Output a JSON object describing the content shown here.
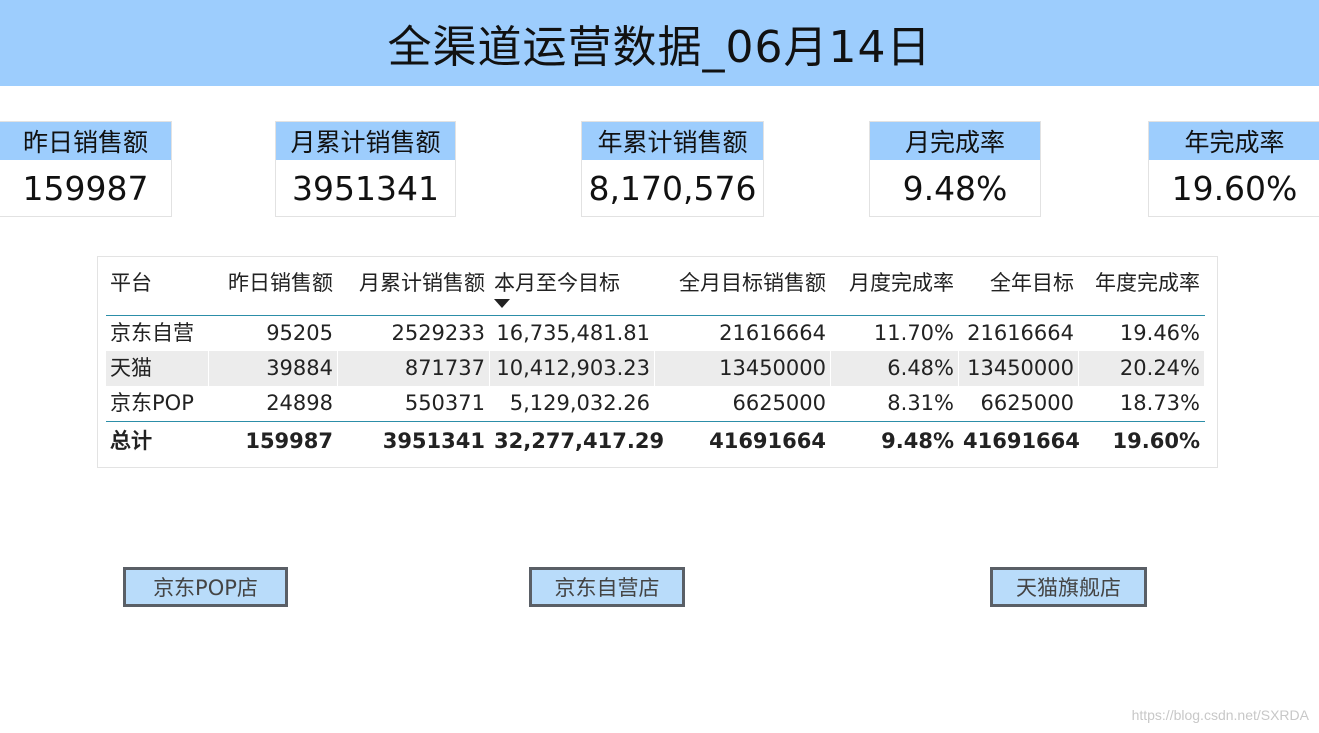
{
  "banner": {
    "title": "全渠道运营数据_06月14日"
  },
  "kpis": [
    {
      "label": "昨日销售额",
      "value": "159987"
    },
    {
      "label": "月累计销售额",
      "value": "3951341"
    },
    {
      "label": "年累计销售额",
      "value": "8,170,576"
    },
    {
      "label": "月完成率",
      "value": "9.48%"
    },
    {
      "label": "年完成率",
      "value": "19.60%"
    }
  ],
  "table": {
    "columns": [
      "平台",
      "昨日销售额",
      "月累计销售额",
      "本月至今目标",
      "全月目标销售额",
      "月度完成率",
      "全年目标",
      "年度完成率"
    ],
    "rows": [
      [
        "京东自营",
        "95205",
        "2529233",
        "16,735,481.81",
        "21616664",
        "11.70%",
        "21616664",
        "19.46%"
      ],
      [
        "天猫",
        "39884",
        "871737",
        "10,412,903.23",
        "13450000",
        "6.48%",
        "13450000",
        "20.24%"
      ],
      [
        "京东POP",
        "24898",
        "550371",
        "5,129,032.26",
        "6625000",
        "8.31%",
        "6625000",
        "18.73%"
      ]
    ],
    "total": [
      "总计",
      "159987",
      "3951341",
      "32,277,417.29",
      "41691664",
      "9.48%",
      "41691664",
      "19.60%"
    ],
    "sort_icon": "sort-descending-icon"
  },
  "nav_buttons": [
    {
      "label": "京东POP店"
    },
    {
      "label": "京东自营店"
    },
    {
      "label": "天猫旗舰店"
    }
  ],
  "watermark": "https://blog.csdn.net/SXRDA",
  "colors": {
    "accent": "#9dcdfd",
    "button_fill": "#b9dcfa",
    "separator": "#2c8ea8",
    "alt_row": "#ececec"
  }
}
